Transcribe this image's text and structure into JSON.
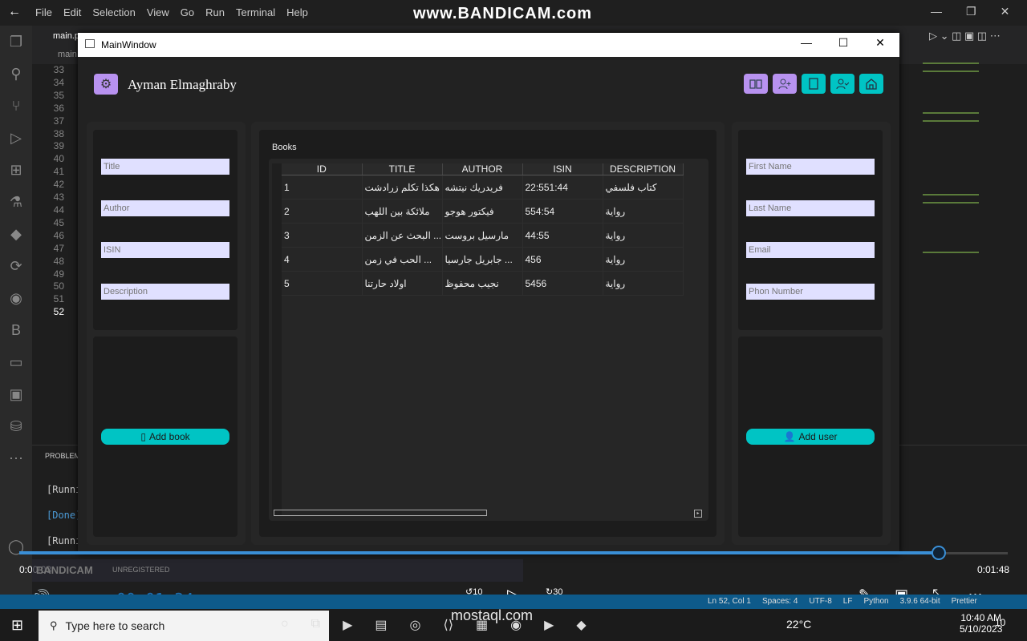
{
  "vscode": {
    "menu": [
      "File",
      "Edit",
      "Selection",
      "View",
      "Go",
      "Run",
      "Terminal",
      "Help"
    ],
    "watermark": "www.BANDICAM.com",
    "tab1": "main.p",
    "tab2": "main",
    "line_numbers": [
      "33",
      "34",
      "35",
      "36",
      "37",
      "38",
      "39",
      "40",
      "41",
      "42",
      "43",
      "44",
      "45",
      "46",
      "47",
      "48",
      "49",
      "50",
      "51",
      "52"
    ],
    "panel_title": "PROBLEM",
    "panel_lines": [
      "[Runni",
      "[Done]",
      "[Runni"
    ]
  },
  "window": {
    "title": "MainWindow",
    "user_name": "Ayman Elmaghraby",
    "header_buttons": [
      {
        "icon": "book-open-icon",
        "color": "#b892f0"
      },
      {
        "icon": "user-add-icon",
        "color": "#b892f0"
      },
      {
        "icon": "book-icon",
        "color": "#00c4c4"
      },
      {
        "icon": "user-check-icon",
        "color": "#00c4c4"
      },
      {
        "icon": "home-icon",
        "color": "#00c4c4"
      }
    ],
    "book_form": {
      "title_ph": "Title",
      "author_ph": "Author",
      "isin_ph": "ISIN",
      "description_ph": "Description",
      "add_label": "Add book"
    },
    "user_form": {
      "first_ph": "First Name",
      "last_ph": "Last Name",
      "email_ph": "Email",
      "phone_ph": "Phon Number",
      "add_label": "Add user"
    },
    "books": {
      "label": "Books",
      "columns": [
        "ID",
        "TITLE",
        "AUTHOR",
        "ISIN",
        "DESCRIPTION"
      ],
      "rows": [
        [
          "1",
          "هكذا تكلم زرادشت",
          "فريدريك نيتشه",
          "22:551:44",
          "كتاب فلسفي"
        ],
        [
          "2",
          "ملائكة بين اللهب",
          "فيكتور هوجو",
          "554:54",
          "رواية"
        ],
        [
          "3",
          "... البحث عن الزمن",
          "مارسيل بروست",
          "44:55",
          "رواية"
        ],
        [
          "4",
          "... الحب في زمن",
          "... جابريل جارسيا",
          "456",
          "رواية"
        ],
        [
          "5",
          "اولاد حارتنا",
          "نجيب محفوظ",
          "5456",
          "رواية"
        ]
      ]
    }
  },
  "player": {
    "elapsed": "0:00:03",
    "total": "0:01:48",
    "progress": 0.93,
    "bandicam": "BANDICAM",
    "unregistered": "UNREGISTERED",
    "timer": "00:01:34",
    "skip_back": "10",
    "skip_fwd": "30",
    "overlay": "mostaql.com"
  },
  "statusbar": {
    "items": [
      "Ln 52, Col 1",
      "Spaces: 4",
      "UTF-8",
      "LF",
      "Python",
      "3.9.6 64-bit",
      "Prettier"
    ]
  },
  "taskbar": {
    "search_ph": "Type here to search",
    "weather": "22°C",
    "time": "10:40 AM",
    "date": "5/10/2023",
    "notif": "10"
  }
}
